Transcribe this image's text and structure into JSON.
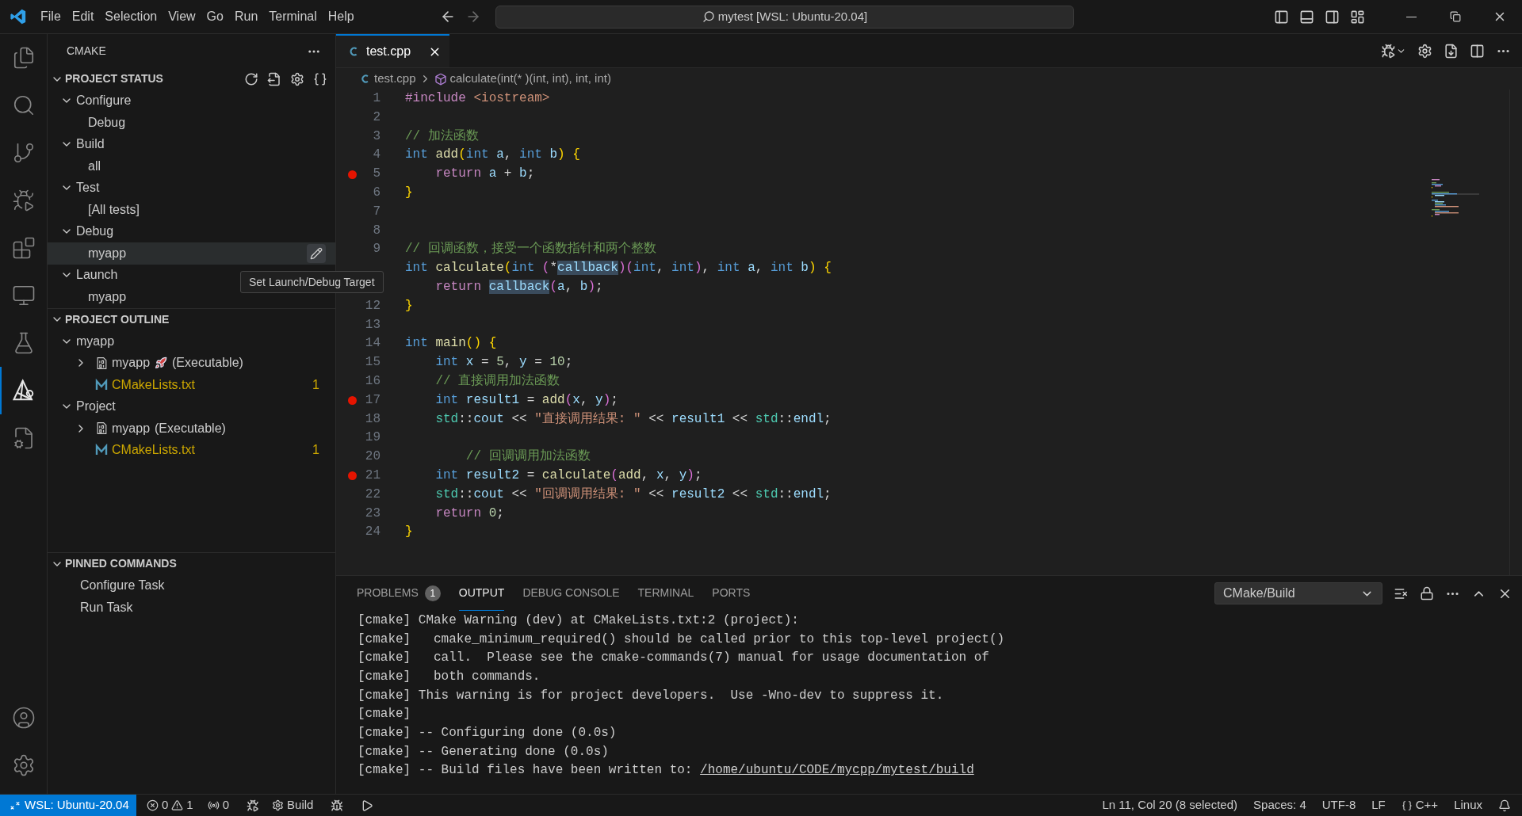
{
  "window": {
    "title": "mytest [WSL: Ubuntu-20.04]"
  },
  "menu": [
    "File",
    "Edit",
    "Selection",
    "View",
    "Go",
    "Run",
    "Terminal",
    "Help"
  ],
  "nav_buttons": [
    {
      "disabled": false
    },
    {
      "disabled": true
    }
  ],
  "activity_bar": [
    {
      "selected": false
    },
    {
      "selected": false
    },
    {
      "selected": false
    },
    {
      "selected": false
    },
    {
      "selected": false
    },
    {
      "selected": false
    },
    {
      "selected": false
    },
    {
      "selected": true
    },
    {
      "selected": false
    }
  ],
  "sidebar": {
    "title": "CMAKE",
    "project_status": {
      "title": "PROJECT STATUS",
      "expanded": true,
      "groups": [
        {
          "label": "Configure",
          "expanded": true,
          "children": [
            {
              "label": "Debug",
              "selected": false
            }
          ]
        },
        {
          "label": "Build",
          "expanded": true,
          "children": [
            {
              "label": "all",
              "selected": false
            }
          ]
        },
        {
          "label": "Test",
          "expanded": true,
          "children": [
            {
              "label": "[All tests]",
              "selected": false
            }
          ]
        },
        {
          "label": "Debug",
          "expanded": true,
          "children": [
            {
              "label": "myapp",
              "selected": true
            }
          ]
        },
        {
          "label": "Launch",
          "expanded": true,
          "children": [
            {
              "label": "myapp",
              "selected": false
            }
          ]
        }
      ]
    },
    "project_outline": {
      "title": "PROJECT OUTLINE",
      "expanded": true,
      "groups": [
        {
          "label": "myapp",
          "expanded": true,
          "children": [
            {
              "kind": "target",
              "label": "myapp",
              "launch": true,
              "suffix": "(Executable)",
              "expanded": false
            },
            {
              "kind": "file",
              "label": "CMakeLists.txt",
              "badge": "1"
            }
          ]
        },
        {
          "label": "Project",
          "expanded": true,
          "children": [
            {
              "kind": "target",
              "label": "myapp",
              "launch": false,
              "suffix": "(Executable)",
              "expanded": false
            },
            {
              "kind": "file",
              "label": "CMakeLists.txt",
              "badge": "1"
            }
          ]
        }
      ]
    },
    "pinned_commands": {
      "title": "PINNED COMMANDS",
      "expanded": true,
      "items": [
        "Configure Task",
        "Run Task"
      ]
    }
  },
  "tooltip": "Set Launch/Debug Target",
  "editor": {
    "tabs": [
      {
        "label": "test.cpp",
        "selected": true
      }
    ],
    "breadcrumb": [
      "test.cpp",
      "calculate(int(* )(int, int), int, int)"
    ],
    "lines": [
      {
        "number": "1",
        "breakpoint": false,
        "tokens": [
          {
            "text": "#include ",
            "kind": "ctl"
          },
          {
            "text": "<iostream>",
            "kind": "str"
          }
        ]
      },
      {
        "number": "2",
        "breakpoint": false
      },
      {
        "number": "3",
        "breakpoint": false,
        "tokens": [
          {
            "text": "// 加法函数",
            "kind": "cmt"
          }
        ]
      },
      {
        "number": "4",
        "breakpoint": false,
        "tokens": [
          {
            "text": "int ",
            "kind": "kw"
          },
          {
            "text": "add",
            "kind": "fn"
          },
          {
            "text": "(",
            "kind": "b1"
          },
          {
            "text": "int ",
            "kind": "kw"
          },
          {
            "text": "a",
            "kind": "var"
          },
          {
            "text": ", ",
            "kind": "plain"
          },
          {
            "text": "int ",
            "kind": "kw"
          },
          {
            "text": "b",
            "kind": "var"
          },
          {
            "text": ")",
            "kind": "b1"
          },
          {
            "text": " {",
            "kind": "b1"
          }
        ]
      },
      {
        "number": "5",
        "breakpoint": true,
        "tokens": [
          {
            "text": "    return ",
            "kind": "ctl"
          },
          {
            "text": "a",
            "kind": "var"
          },
          {
            "text": " + ",
            "kind": "plain"
          },
          {
            "text": "b",
            "kind": "var"
          },
          {
            "text": ";",
            "kind": "plain"
          }
        ]
      },
      {
        "number": "6",
        "breakpoint": false,
        "tokens": [
          {
            "text": "}",
            "kind": "b1"
          }
        ]
      },
      {
        "number": "7",
        "breakpoint": false
      },
      {
        "number": "8",
        "breakpoint": false
      },
      {
        "number": "9",
        "breakpoint": false,
        "tokens": [
          {
            "text": "// 回调函数，接受一个函数指针和两个整数",
            "kind": "cmt"
          }
        ]
      },
      {
        "breakpoint": false,
        "tokens": [
          {
            "text": "int ",
            "kind": "kw"
          },
          {
            "text": "calculate",
            "kind": "fn"
          },
          {
            "text": "(",
            "kind": "b1"
          },
          {
            "text": "int ",
            "kind": "kw"
          },
          {
            "text": "(",
            "kind": "b2"
          },
          {
            "text": "*",
            "kind": "plain"
          },
          {
            "text": "callback",
            "kind": "hl"
          },
          {
            "text": ")",
            "kind": "b2"
          },
          {
            "text": "(",
            "kind": "b2"
          },
          {
            "text": "int",
            "kind": "kw"
          },
          {
            "text": ", ",
            "kind": "plain"
          },
          {
            "text": "int",
            "kind": "kw"
          },
          {
            "text": ")",
            "kind": "b2"
          },
          {
            "text": ", ",
            "kind": "plain"
          },
          {
            "text": "int ",
            "kind": "kw"
          },
          {
            "text": "a",
            "kind": "var"
          },
          {
            "text": ", ",
            "kind": "plain"
          },
          {
            "text": "int ",
            "kind": "kw"
          },
          {
            "text": "b",
            "kind": "var"
          },
          {
            "text": ")",
            "kind": "b1"
          },
          {
            "text": " {",
            "kind": "b1"
          }
        ]
      },
      {
        "breakpoint": false,
        "tokens": [
          {
            "text": "    return ",
            "kind": "ctl"
          },
          {
            "text": "callback",
            "kind": "hl"
          },
          {
            "text": "(",
            "kind": "b2"
          },
          {
            "text": "a",
            "kind": "var"
          },
          {
            "text": ", ",
            "kind": "plain"
          },
          {
            "text": "b",
            "kind": "var"
          },
          {
            "text": ")",
            "kind": "b2"
          },
          {
            "text": ";",
            "kind": "plain"
          }
        ]
      },
      {
        "number": "12",
        "breakpoint": false,
        "tokens": [
          {
            "text": "}",
            "kind": "b1"
          }
        ]
      },
      {
        "number": "13",
        "breakpoint": false
      },
      {
        "number": "14",
        "breakpoint": false,
        "tokens": [
          {
            "text": "int ",
            "kind": "kw"
          },
          {
            "text": "main",
            "kind": "fn"
          },
          {
            "text": "(",
            "kind": "b1"
          },
          {
            "text": ")",
            "kind": "b1"
          },
          {
            "text": " {",
            "kind": "b1"
          }
        ]
      },
      {
        "number": "15",
        "breakpoint": false,
        "tokens": [
          {
            "text": "    int ",
            "kind": "kw"
          },
          {
            "text": "x",
            "kind": "var"
          },
          {
            "text": " = ",
            "kind": "plain"
          },
          {
            "text": "5",
            "kind": "num"
          },
          {
            "text": ", ",
            "kind": "plain"
          },
          {
            "text": "y",
            "kind": "var"
          },
          {
            "text": " = ",
            "kind": "plain"
          },
          {
            "text": "10",
            "kind": "num"
          },
          {
            "text": ";",
            "kind": "plain"
          }
        ]
      },
      {
        "number": "16",
        "breakpoint": false,
        "tokens": [
          {
            "text": "    // 直接调用加法函数",
            "kind": "cmt"
          }
        ]
      },
      {
        "number": "17",
        "breakpoint": true,
        "tokens": [
          {
            "text": "    int ",
            "kind": "kw"
          },
          {
            "text": "result1",
            "kind": "var"
          },
          {
            "text": " = ",
            "kind": "plain"
          },
          {
            "text": "add",
            "kind": "fn"
          },
          {
            "text": "(",
            "kind": "b2"
          },
          {
            "text": "x",
            "kind": "var"
          },
          {
            "text": ", ",
            "kind": "plain"
          },
          {
            "text": "y",
            "kind": "var"
          },
          {
            "text": ")",
            "kind": "b2"
          },
          {
            "text": ";",
            "kind": "plain"
          }
        ]
      },
      {
        "number": "18",
        "breakpoint": false,
        "tokens": [
          {
            "text": "    std",
            "kind": "ns"
          },
          {
            "text": "::",
            "kind": "plain"
          },
          {
            "text": "cout",
            "kind": "var"
          },
          {
            "text": " << ",
            "kind": "plain"
          },
          {
            "text": "\"直接调用结果: \"",
            "kind": "str"
          },
          {
            "text": " << ",
            "kind": "plain"
          },
          {
            "text": "result1",
            "kind": "var"
          },
          {
            "text": " << ",
            "kind": "plain"
          },
          {
            "text": "std",
            "kind": "ns"
          },
          {
            "text": "::",
            "kind": "plain"
          },
          {
            "text": "endl",
            "kind": "var"
          },
          {
            "text": ";",
            "kind": "plain"
          }
        ]
      },
      {
        "number": "19",
        "breakpoint": false
      },
      {
        "number": "20",
        "breakpoint": false,
        "tokens": [
          {
            "text": "        // 回调调用加法函数",
            "kind": "cmt"
          }
        ]
      },
      {
        "number": "21",
        "breakpoint": true,
        "tokens": [
          {
            "text": "    int ",
            "kind": "kw"
          },
          {
            "text": "result2",
            "kind": "var"
          },
          {
            "text": " = ",
            "kind": "plain"
          },
          {
            "text": "calculate",
            "kind": "fn"
          },
          {
            "text": "(",
            "kind": "b2"
          },
          {
            "text": "add",
            "kind": "fn"
          },
          {
            "text": ", ",
            "kind": "plain"
          },
          {
            "text": "x",
            "kind": "var"
          },
          {
            "text": ", ",
            "kind": "plain"
          },
          {
            "text": "y",
            "kind": "var"
          },
          {
            "text": ")",
            "kind": "b2"
          },
          {
            "text": ";",
            "kind": "plain"
          }
        ]
      },
      {
        "number": "22",
        "breakpoint": false,
        "tokens": [
          {
            "text": "    std",
            "kind": "ns"
          },
          {
            "text": "::",
            "kind": "plain"
          },
          {
            "text": "cout",
            "kind": "var"
          },
          {
            "text": " << ",
            "kind": "plain"
          },
          {
            "text": "\"回调调用结果: \"",
            "kind": "str"
          },
          {
            "text": " << ",
            "kind": "plain"
          },
          {
            "text": "result2",
            "kind": "var"
          },
          {
            "text": " << ",
            "kind": "plain"
          },
          {
            "text": "std",
            "kind": "ns"
          },
          {
            "text": "::",
            "kind": "plain"
          },
          {
            "text": "endl",
            "kind": "var"
          },
          {
            "text": ";",
            "kind": "plain"
          }
        ]
      },
      {
        "number": "23",
        "breakpoint": false,
        "tokens": [
          {
            "text": "    return ",
            "kind": "ctl"
          },
          {
            "text": "0",
            "kind": "num"
          },
          {
            "text": ";",
            "kind": "plain"
          }
        ]
      },
      {
        "number": "24",
        "breakpoint": false,
        "tokens": [
          {
            "text": "}",
            "kind": "b1"
          }
        ]
      }
    ]
  },
  "panel": {
    "tabs": [
      {
        "label": "PROBLEMS",
        "badge": "1",
        "selected": false
      },
      {
        "label": "OUTPUT",
        "selected": true
      },
      {
        "label": "DEBUG CONSOLE",
        "selected": false
      },
      {
        "label": "TERMINAL",
        "selected": false
      },
      {
        "label": "PORTS",
        "selected": false
      }
    ],
    "channel": "CMake/Build",
    "lines": [
      {
        "text": "[cmake] CMake Warning (dev) at CMakeLists.txt:2 (project):"
      },
      {
        "text": "[cmake]   cmake_minimum_required() should be called prior to this top-level project()"
      },
      {
        "text": "[cmake]   call.  Please see the cmake-commands(7) manual for usage documentation of"
      },
      {
        "text": "[cmake]   both commands."
      },
      {
        "text": "[cmake] This warning is for project developers.  Use -Wno-dev to suppress it."
      },
      {
        "text": "[cmake]"
      },
      {
        "text": "[cmake] -- Configuring done (0.0s)"
      },
      {
        "text": "[cmake] -- Generating done (0.0s)"
      },
      {
        "text": "[cmake] -- Build files have been written to: ",
        "link": "/home/ubuntu/CODE/mycpp/mytest/build"
      }
    ]
  },
  "status_bar": {
    "remote": "WSL: Ubuntu-20.04",
    "errors": "0",
    "warnings": "1",
    "ports": "0",
    "build": "Build",
    "right": [
      {
        "kind": "text",
        "text": "Ln 11, Col 20 (8 selected)"
      },
      {
        "kind": "text",
        "text": "Spaces: 4"
      },
      {
        "kind": "text",
        "text": "UTF-8"
      },
      {
        "kind": "text",
        "text": "LF"
      },
      {
        "kind": "language",
        "text": "C++"
      },
      {
        "kind": "text",
        "text": "Linux"
      }
    ]
  }
}
